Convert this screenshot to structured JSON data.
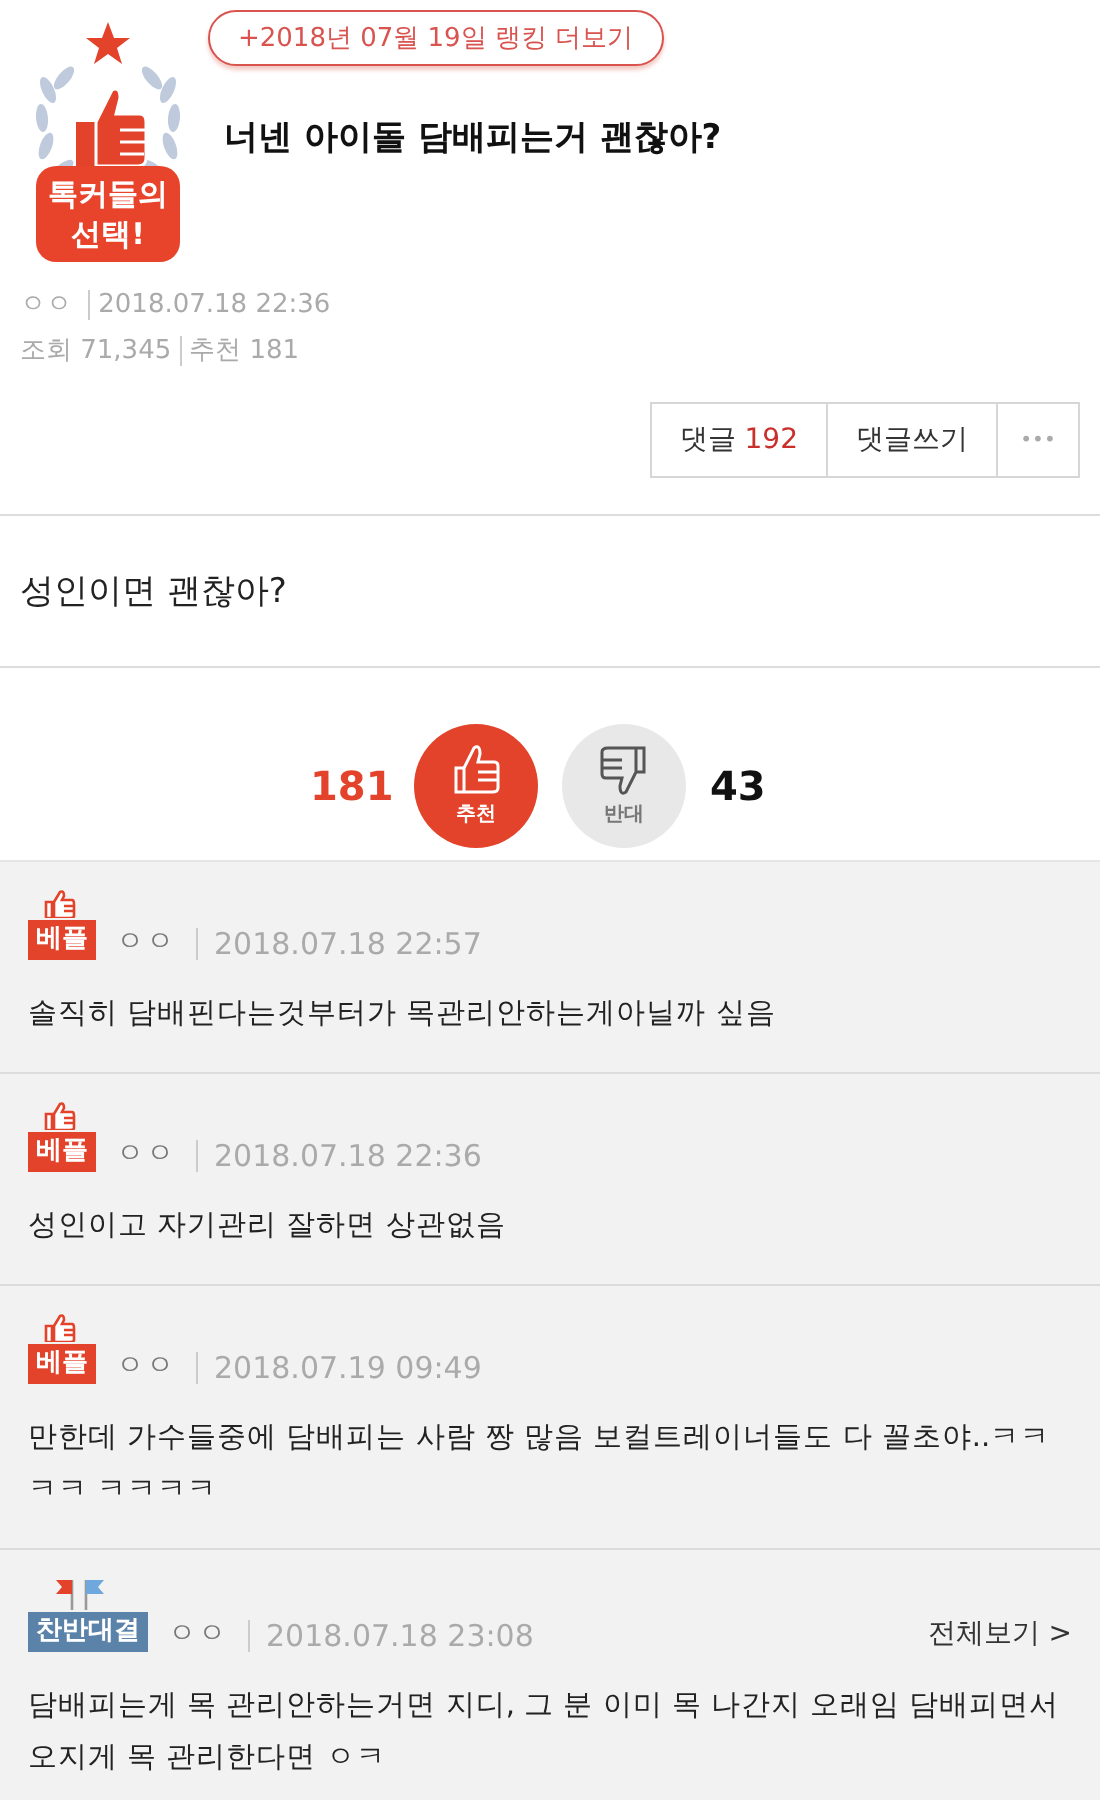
{
  "ranking_link": "+2018년 07월 19일 랭킹 더보기",
  "award_badge": "톡커들의 선택!",
  "post": {
    "title": "너넨 아이돌 담배피는거 괜찮아?",
    "author": "ㅇㅇ",
    "date": "2018.07.18 22:36",
    "views_label": "조회",
    "views": "71,345",
    "recommend_label": "추천",
    "recommend": "181",
    "body": "성인이면 괜찮아?"
  },
  "actions": {
    "comments_label": "댓글",
    "comments_count": "192",
    "write": "댓글쓰기",
    "more": "•••"
  },
  "vote": {
    "up_count": "181",
    "up_label": "추천",
    "down_label": "반대",
    "down_count": "43"
  },
  "comments": [
    {
      "kind": "best",
      "badge": "베플",
      "author": "ㅇㅇ",
      "date": "2018.07.18 22:57",
      "text": "솔직히 담배핀다는것부터가 목관리안하는게아닐까 싶음"
    },
    {
      "kind": "best",
      "badge": "베플",
      "author": "ㅇㅇ",
      "date": "2018.07.18 22:36",
      "text": "성인이고 자기관리 잘하면 상관없음"
    },
    {
      "kind": "best",
      "badge": "베플",
      "author": "ㅇㅇ",
      "date": "2018.07.19 09:49",
      "text": "만한데 가수들중에 담배피는 사람 짱 많음 보컬트레이너들도 다 꼴초야..ㅋㅋㅋㅋ ㅋㅋㅋㅋ"
    },
    {
      "kind": "versus",
      "badge": "찬반대결",
      "author": "ㅇㅇ",
      "date": "2018.07.18 23:08",
      "link": "전체보기 >",
      "text": "담배피는게 목 관리안하는거면 지디, 그 분 이미 목 나간지 오래임 담배피면서 오지게 목 관리한다면 ㅇㅋ"
    }
  ]
}
